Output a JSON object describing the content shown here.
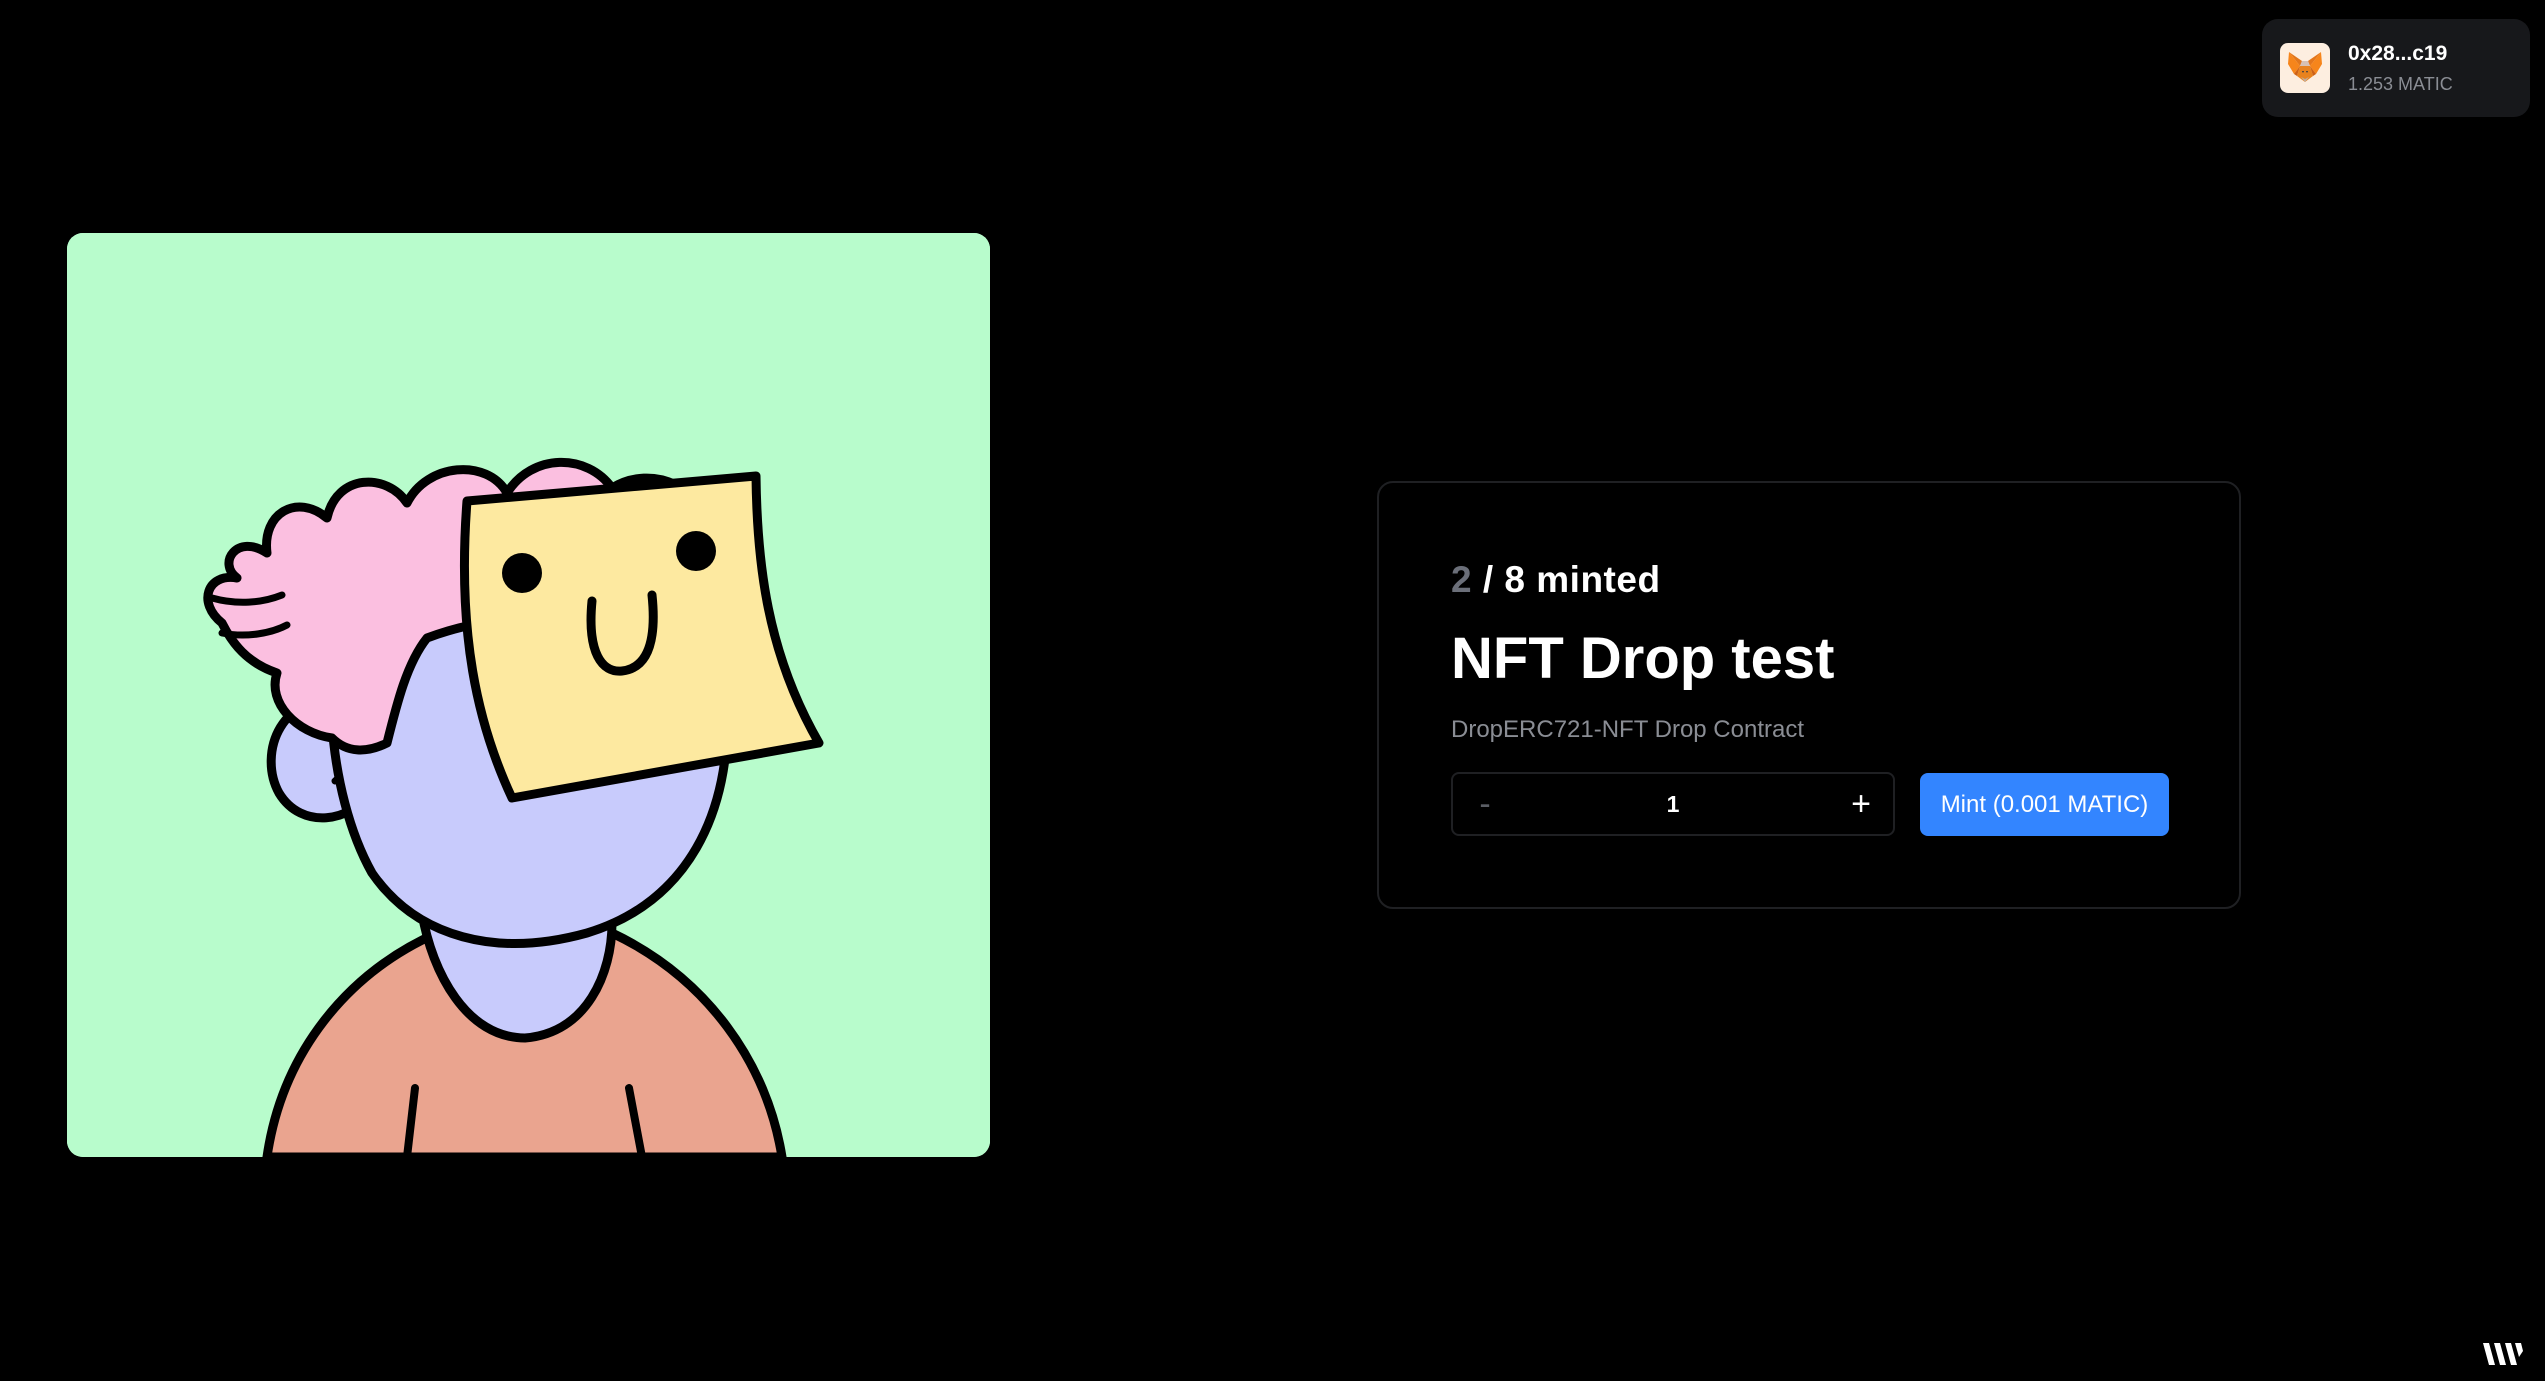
{
  "wallet": {
    "address": "0x28...c19",
    "balance": "1.253 MATIC",
    "icon": "metamask-fox-icon"
  },
  "nft": {
    "image": "nft-avatar-character",
    "background_color": "#b8fccc"
  },
  "card": {
    "minted_count": "2",
    "minted_suffix": " / 8 minted",
    "title": "NFT Drop test",
    "description": "DropERC721-NFT Drop Contract",
    "quantity": {
      "decrement_label": "-",
      "value": "1",
      "increment_label": "+"
    },
    "mint_button_label": "Mint (0.001 MATIC)",
    "accent_color": "#3385ff"
  },
  "footer": {
    "logo": "thirdweb-logo-icon"
  }
}
